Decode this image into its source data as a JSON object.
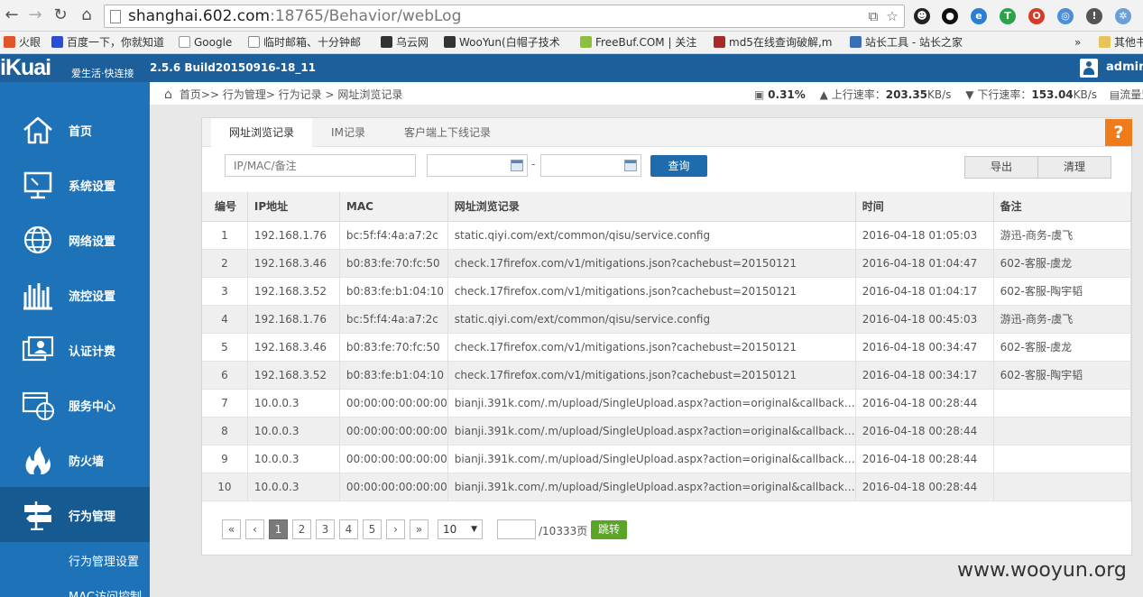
{
  "browser": {
    "url_host": "shanghai.602.com",
    "url_rest": ":18765/Behavior/webLog",
    "bookmarks": [
      "火眼",
      "百度一下，你就知道",
      "Google",
      "临时邮箱、十分钟邮",
      "乌云网",
      "WooYun(白帽子技术",
      "FreeBuf.COM | 关注",
      "md5在线查询破解,m",
      "站长工具 - 站长之家",
      "»",
      "其他书"
    ]
  },
  "header": {
    "logo": "iKuai",
    "slogan": "爱生活·快连接",
    "version": "2.5.6 Build20150916-18_11",
    "user": "admin"
  },
  "sidebar": {
    "items": [
      {
        "label": "首页",
        "icon": "home-icon"
      },
      {
        "label": "系统设置",
        "icon": "monitor-icon"
      },
      {
        "label": "网络设置",
        "icon": "globe-icon"
      },
      {
        "label": "流控设置",
        "icon": "bars-icon"
      },
      {
        "label": "认证计费",
        "icon": "auth-icon"
      },
      {
        "label": "服务中心",
        "icon": "service-icon"
      },
      {
        "label": "防火墙",
        "icon": "firewall-icon"
      },
      {
        "label": "行为管理",
        "icon": "signpost-icon"
      }
    ],
    "sub_items": [
      "行为管理设置",
      "MAC访问控制"
    ]
  },
  "breadcrumb": {
    "path": "首页>>  行为管理>  行为记录 >  网址浏览记录"
  },
  "stats": {
    "cpu": "0.31%",
    "up_label": "上行速率：",
    "up_value": "203.35",
    "up_unit": "KB/s",
    "down_label": "下行速率：",
    "down_value": "153.04",
    "down_unit": "KB/s",
    "flow": "流量监"
  },
  "tabs": [
    "网址浏览记录",
    "IM记录",
    "客户端上下线记录"
  ],
  "filter": {
    "placeholder": "IP/MAC/备注",
    "query": "查询",
    "export": "导出",
    "clear": "清理",
    "sep": "-"
  },
  "help": "?",
  "table": {
    "columns": [
      "编号",
      "IP地址",
      "MAC",
      "网址浏览记录",
      "时间",
      "备注"
    ],
    "rows": [
      [
        "1",
        "192.168.1.76",
        "bc:5f:f4:4a:a7:2c",
        "static.qiyi.com/ext/common/qisu/service.config",
        "2016-04-18 01:05:03",
        "游迅-商务-虞飞"
      ],
      [
        "2",
        "192.168.3.46",
        "b0:83:fe:70:fc:50",
        "check.17firefox.com/v1/mitigations.json?cachebust=20150121",
        "2016-04-18 01:04:47",
        "602-客服-虞龙"
      ],
      [
        "3",
        "192.168.3.52",
        "b0:83:fe:b1:04:10",
        "check.17firefox.com/v1/mitigations.json?cachebust=20150121",
        "2016-04-18 01:04:17",
        "602-客服-陶宇韬"
      ],
      [
        "4",
        "192.168.1.76",
        "bc:5f:f4:4a:a7:2c",
        "static.qiyi.com/ext/common/qisu/service.config",
        "2016-04-18 00:45:03",
        "游迅-商务-虞飞"
      ],
      [
        "5",
        "192.168.3.46",
        "b0:83:fe:70:fc:50",
        "check.17firefox.com/v1/mitigations.json?cachebust=20150121",
        "2016-04-18 00:34:47",
        "602-客服-虞龙"
      ],
      [
        "6",
        "192.168.3.52",
        "b0:83:fe:b1:04:10",
        "check.17firefox.com/v1/mitigations.json?cachebust=20150121",
        "2016-04-18 00:34:17",
        "602-客服-陶宇韬"
      ],
      [
        "7",
        "10.0.0.3",
        "00:00:00:00:00:00",
        "bianji.391k.com/.m/upload/SingleUpload.aspx?action=original&callback=w...",
        "2016-04-18 00:28:44",
        ""
      ],
      [
        "8",
        "10.0.0.3",
        "00:00:00:00:00:00",
        "bianji.391k.com/.m/upload/SingleUpload.aspx?action=original&callback=w...",
        "2016-04-18 00:28:44",
        ""
      ],
      [
        "9",
        "10.0.0.3",
        "00:00:00:00:00:00",
        "bianji.391k.com/.m/upload/SingleUpload.aspx?action=original&callback=w...",
        "2016-04-18 00:28:44",
        ""
      ],
      [
        "10",
        "10.0.0.3",
        "00:00:00:00:00:00",
        "bianji.391k.com/.m/upload/SingleUpload.aspx?action=original&callback=w...",
        "2016-04-18 00:28:44",
        ""
      ]
    ]
  },
  "pager": {
    "first": "«",
    "prev": "‹",
    "pages": [
      "1",
      "2",
      "3",
      "4",
      "5"
    ],
    "next": "›",
    "last": "»",
    "page_size": "10",
    "total": "/10333页",
    "jump": "跳转"
  },
  "watermark": "www.wooyun.org"
}
